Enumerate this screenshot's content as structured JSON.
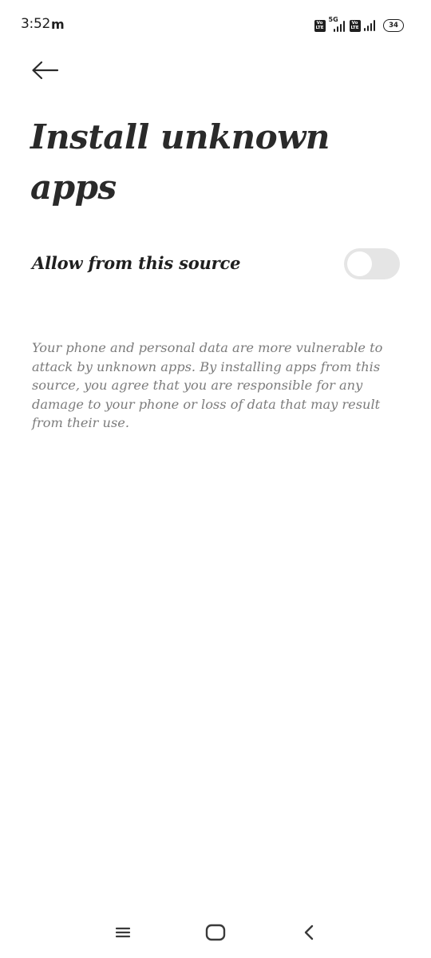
{
  "status_bar": {
    "time": "3:52",
    "notification": "m",
    "network_label": "5G",
    "volte_top": "Vo",
    "volte_bottom": "LTE",
    "battery_level": "34"
  },
  "page": {
    "title": "Install unknown apps"
  },
  "setting": {
    "label": "Allow from this source",
    "enabled": false
  },
  "warning": {
    "text": "Your phone and personal data are more vulnerable to attack by unknown apps. By installing apps from this source, you agree that you are responsible for any damage to your phone or loss of data that may result from their use."
  },
  "colors": {
    "text_primary": "#1f1f1f",
    "text_secondary": "#7c7c7c",
    "toggle_off_track": "#e5e5e5",
    "background": "#ffffff"
  },
  "icons": {
    "back": "arrow-left-icon",
    "nav_recent": "menu-lines-icon",
    "nav_home": "rounded-square-icon",
    "nav_back": "chevron-left-icon"
  }
}
